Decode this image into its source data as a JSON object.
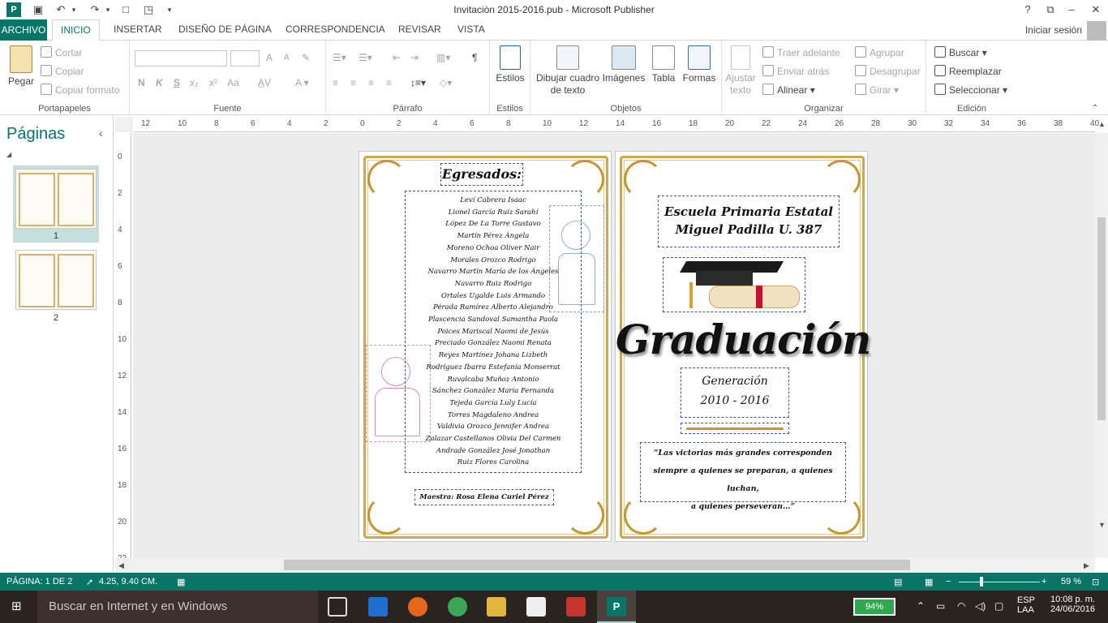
{
  "window": {
    "title": "Invitaciòn 2015-2016.pub - Microsoft Publisher",
    "help": "?",
    "app_badge": "P"
  },
  "tabs": {
    "file": "ARCHIVO",
    "items": [
      "INICIO",
      "INSERTAR",
      "DISEÑO DE PÁGINA",
      "CORRESPONDENCIA",
      "REVISAR",
      "VISTA"
    ],
    "sign_in": "Iniciar sesión"
  },
  "ribbon": {
    "clipboard": {
      "paste": "Pegar",
      "cut": "Cortar",
      "copy": "Copiar",
      "format_painter": "Copiar formato",
      "label": "Portapapeles"
    },
    "font": {
      "label": "Fuente",
      "bold": "N",
      "italic": "K",
      "underline": "S",
      "subscript": "x₂",
      "superscript": "x²",
      "case": "Aa",
      "grow": "A",
      "shrink": "A"
    },
    "paragraph": {
      "label": "Párrafo",
      "pilcrow": "¶"
    },
    "styles": {
      "button": "Estilos",
      "label": "Estilos"
    },
    "objects": {
      "label": "Objetos",
      "draw_textbox_1": "Dibujar cuadro",
      "draw_textbox_2": "de texto",
      "images": "Imágenes",
      "table": "Tabla",
      "shapes": "Formas"
    },
    "arrange": {
      "label": "Organizar",
      "wrap_1": "Ajustar",
      "wrap_2": "texto",
      "bring_forward": "Traer adelante",
      "send_backward": "Enviar atrás",
      "align": "Alinear",
      "group": "Agrupar",
      "ungroup": "Desagrupar",
      "rotate": "Girar"
    },
    "editing": {
      "label": "Edición",
      "find": "Buscar",
      "replace": "Reemplazar",
      "select": "Seleccionar"
    }
  },
  "pages_pane": {
    "title": "Páginas",
    "pages": [
      "1",
      "2"
    ]
  },
  "rulers": {
    "h": [
      "12",
      "10",
      "8",
      "6",
      "4",
      "2",
      "0",
      "2",
      "4",
      "6",
      "8",
      "10",
      "12",
      "14",
      "16",
      "18",
      "20",
      "22",
      "24",
      "26",
      "28",
      "30",
      "32",
      "34",
      "36",
      "38",
      "40"
    ],
    "v": [
      "0",
      "2",
      "4",
      "6",
      "8",
      "10",
      "12",
      "14",
      "16",
      "18",
      "20",
      "22"
    ]
  },
  "doc": {
    "left": {
      "heading": "Egresados:",
      "names": [
        "Leví Cabrera Isaac",
        "Lionel García Ruiz Sarahí",
        "López De La Torre Gustavo",
        "Martín Pérez Ángela",
        "Moreno Ochoa Oliver Nair",
        "Morales Orozco Rodrigo",
        "Navarro Martín María de los Ángeles",
        "Navarro Ruiz Rodrigo",
        "Ortales Ugalde Luis Armando",
        "Pérada Ramírez Alberto Alejandro",
        "Plascencia Sandoval Samantha Paola",
        "Poices Mariscal Naomi de Jesús",
        "Preciado González Naomi Renata",
        "Reyes Martínez Johana Lizbeth",
        "Rodríguez Ibarra Estefanía Monserrat",
        "Ruvalcaba Muñoz Antonio",
        "Sánchez González María Fernanda",
        "Tejeda García Luly Lucía",
        "Torres Magdaleno Andrea",
        "Valdivia Orozco Jennifer Andrea",
        "Zalazar Castellanos Olivia Del Carmen",
        "Andrade González José Jonathan",
        "Ruiz Flores Carolina"
      ],
      "teacher": "Maestra: Rosa Elena Curiel Pérez"
    },
    "right": {
      "school_1": "Escuela Primaria Estatal",
      "school_2": "Miguel Padilla U. 387",
      "title": "Graduación",
      "gen_label": "Generación",
      "gen_years": "2010 - 2016",
      "quote_1": "“Las victorias más grandes corresponden",
      "quote_2": "siempre a quienes se preparan, a quienes luchan,",
      "quote_3": "a quienes perseveran…”"
    }
  },
  "status": {
    "page": "PÁGINA: 1 DE 2",
    "position": "4.25, 9.40 CM.",
    "zoom": "59 %"
  },
  "taskbar": {
    "search": "Buscar en Internet y en Windows",
    "battery": "94%",
    "lang_1": "ESP",
    "lang_2": "LAA",
    "time": "10:08 p. m.",
    "date": "24/06/2016"
  },
  "colors": {
    "accent": "#077568",
    "gold": "#c9962c",
    "guide": "#3c5a8a"
  }
}
